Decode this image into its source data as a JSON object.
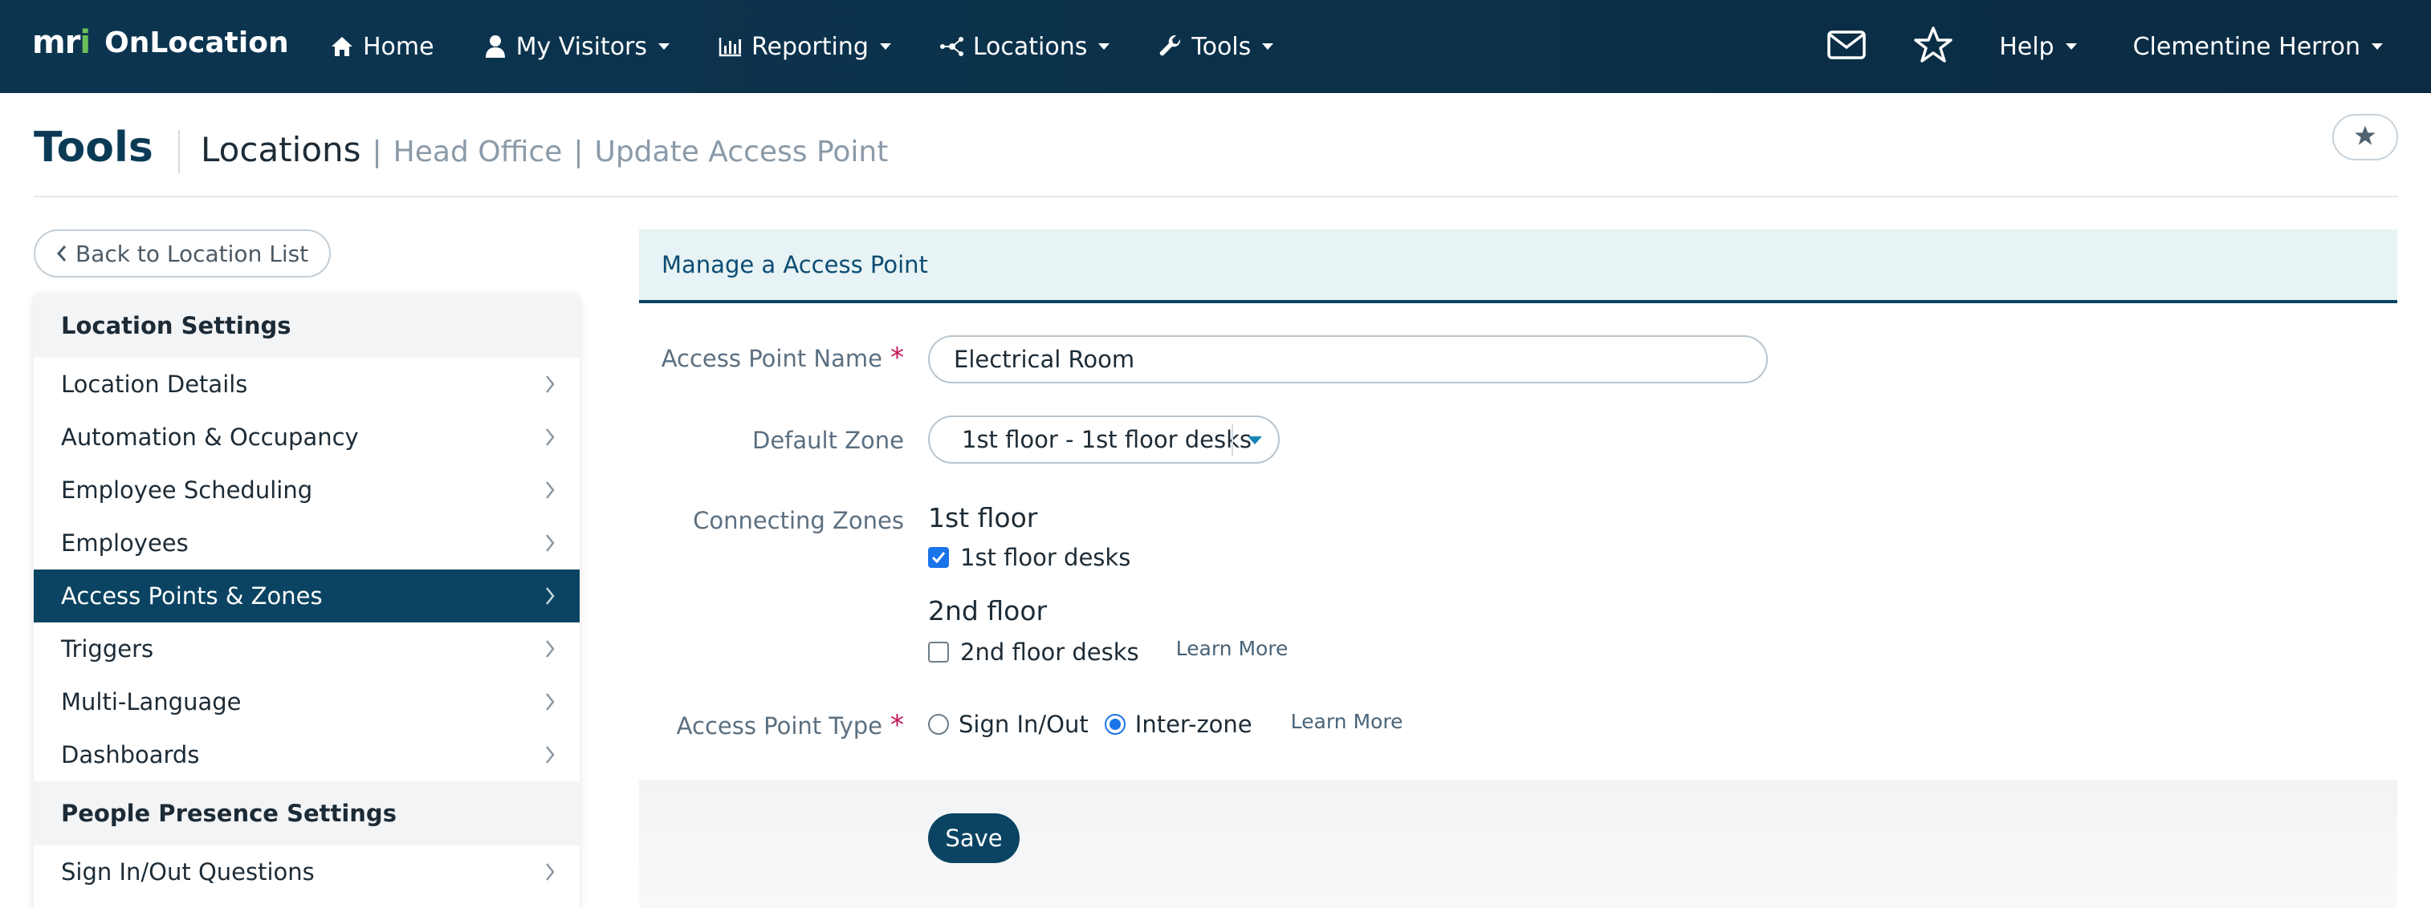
{
  "brand": {
    "mark_left": "mr",
    "mark_right": "i",
    "name": "OnLocation"
  },
  "nav": {
    "items": [
      {
        "label": "Home",
        "icon": "home-icon",
        "has_caret": false
      },
      {
        "label": "My Visitors",
        "icon": "user-icon",
        "has_caret": true
      },
      {
        "label": "Reporting",
        "icon": "bar-chart-icon",
        "has_caret": true
      },
      {
        "label": "Locations",
        "icon": "network-icon",
        "has_caret": true
      },
      {
        "label": "Tools",
        "icon": "wrench-icon",
        "has_caret": true
      }
    ],
    "help_label": "Help",
    "user_label": "Clementine Herron"
  },
  "header": {
    "title": "Tools",
    "crumb_main": "Locations",
    "crumb_divider": "|",
    "crumb_office": "Head Office",
    "crumb_page": "Update Access Point"
  },
  "sidebar": {
    "back_label": "Back to Location List",
    "section1_title": "Location Settings",
    "items": [
      {
        "label": "Location Details",
        "active": false
      },
      {
        "label": "Automation & Occupancy",
        "active": false
      },
      {
        "label": "Employee Scheduling",
        "active": false
      },
      {
        "label": "Employees",
        "active": false
      },
      {
        "label": "Access Points & Zones",
        "active": true
      },
      {
        "label": "Triggers",
        "active": false
      },
      {
        "label": "Multi-Language",
        "active": false
      },
      {
        "label": "Dashboards",
        "active": false
      }
    ],
    "section2_title": "People Presence Settings",
    "items2": [
      {
        "label": "Sign In/Out Questions",
        "active": false
      }
    ]
  },
  "form": {
    "panel_title": "Manage a Access Point",
    "name_label": "Access Point Name",
    "name_value": "Electrical Room",
    "required_mark": "*",
    "zone_label": "Default Zone",
    "zone_value": "1st floor - 1st floor desks",
    "connecting_label": "Connecting Zones",
    "floor1_title": "1st floor",
    "floor1_desks": "1st floor desks",
    "floor1_checked": true,
    "floor2_title": "2nd floor",
    "floor2_desks": "2nd floor desks",
    "floor2_checked": false,
    "learn_more": "Learn More",
    "type_label": "Access Point Type",
    "type_option1": "Sign In/Out",
    "type_option2": "Inter-zone",
    "type_selected": "Inter-zone",
    "save_label": "Save"
  },
  "colors": {
    "nav_bg": "#0c3550",
    "accent": "#0b4462",
    "panel_head_bg": "#e7f3f4",
    "required": "#c4145a",
    "check_blue": "#1a73e8",
    "brand_green": "#6bbf59"
  }
}
